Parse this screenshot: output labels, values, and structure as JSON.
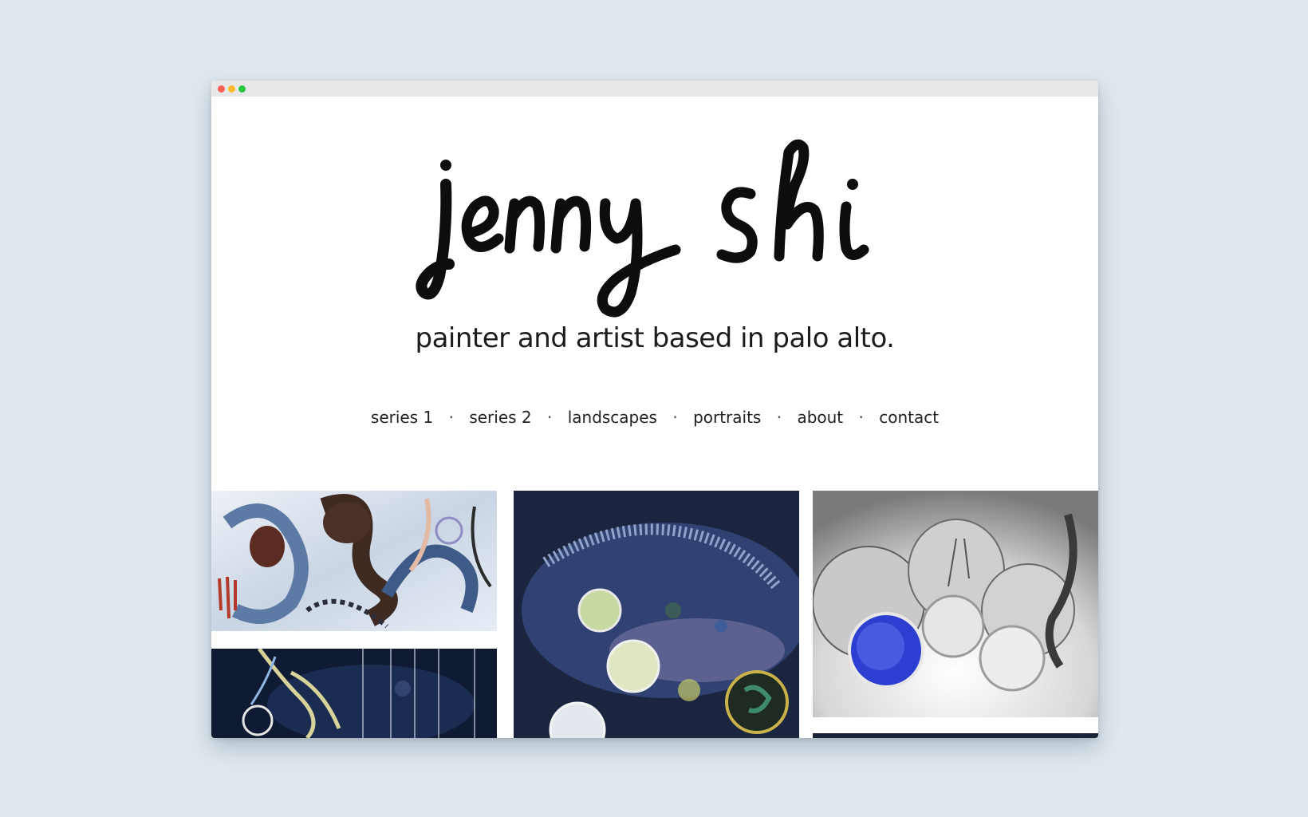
{
  "browser": {
    "controls": [
      "close-dot",
      "minimize-dot",
      "maximize-dot"
    ],
    "colors": {
      "close": "#fe5f57",
      "minimize": "#febc2e",
      "maximize": "#28c840"
    }
  },
  "header": {
    "logo_text": "jenny shi",
    "tagline": "painter and artist based in palo alto."
  },
  "nav": {
    "items": [
      {
        "label": "series 1"
      },
      {
        "label": "series 2"
      },
      {
        "label": "landscapes"
      },
      {
        "label": "portraits"
      },
      {
        "label": "about"
      },
      {
        "label": "contact"
      }
    ],
    "separator": "·"
  },
  "gallery": {
    "tiles": [
      {
        "name": "abstract-painting-swirls",
        "palette": [
          "#e9edf4",
          "#4a3027",
          "#6f8db0",
          "#b23a2a"
        ]
      },
      {
        "name": "cell-petri-dishes-painting",
        "palette": [
          "#1c2540",
          "#3b4d7c",
          "#c6d7a0",
          "#e2e6d9"
        ]
      },
      {
        "name": "glass-jars-blue-photograph",
        "palette": [
          "#f0f0f0",
          "#9a9a9a",
          "#2c3fd1",
          "#3a3a3a"
        ]
      },
      {
        "name": "abstract-neural-blue-painting",
        "palette": [
          "#0f1a33",
          "#2a4a7c",
          "#c8c48a",
          "#e8e8e8"
        ]
      },
      {
        "name": "dark-painting-partial",
        "palette": [
          "#1a2238"
        ]
      }
    ]
  }
}
